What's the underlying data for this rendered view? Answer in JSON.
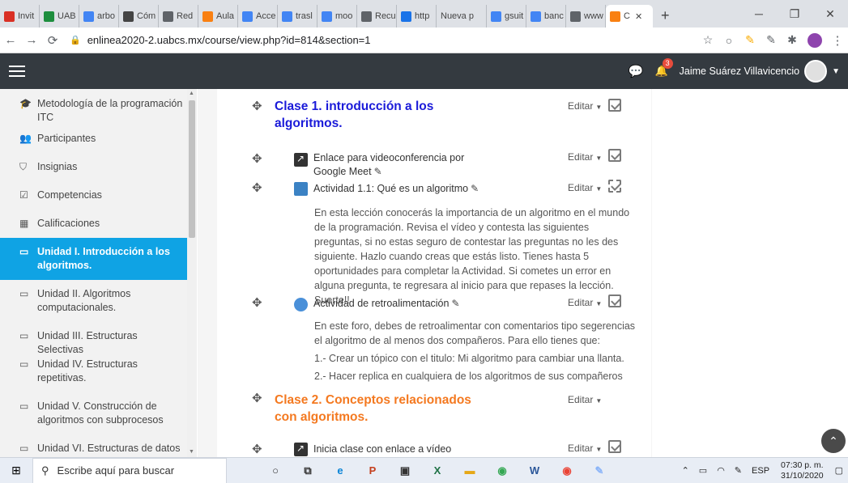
{
  "browser": {
    "tabs": [
      {
        "label": "Invit",
        "icon": "gmail-icon",
        "color": "#d93025"
      },
      {
        "label": "UAB",
        "icon": "classroom-icon",
        "color": "#1e8e3e"
      },
      {
        "label": "arbo",
        "icon": "google-icon",
        "color": "#4285f4"
      },
      {
        "label": "Cóm",
        "icon": "video-icon",
        "color": "#444"
      },
      {
        "label": "Red",
        "icon": "globe-icon",
        "color": "#5f6368"
      },
      {
        "label": "Aula",
        "icon": "moodle-icon",
        "color": "#f98012"
      },
      {
        "label": "Acce",
        "icon": "google-icon",
        "color": "#4285f4"
      },
      {
        "label": "trasl",
        "icon": "google-icon",
        "color": "#4285f4"
      },
      {
        "label": "moo",
        "icon": "google-icon",
        "color": "#4285f4"
      },
      {
        "label": "Recu",
        "icon": "lab-icon",
        "color": "#5f6368"
      },
      {
        "label": "http",
        "icon": "window-icon",
        "color": "#1a73e8"
      },
      {
        "label": "Nueva p",
        "icon": "",
        "color": ""
      },
      {
        "label": "gsuit",
        "icon": "google-icon",
        "color": "#4285f4"
      },
      {
        "label": "banc",
        "icon": "google-icon",
        "color": "#4285f4"
      },
      {
        "label": "www",
        "icon": "globe-icon",
        "color": "#5f6368"
      },
      {
        "label": "C",
        "icon": "moodle-icon",
        "color": "#f98012",
        "active": true
      }
    ],
    "url": "enlinea2020-2.uabcs.mx/course/view.php?id=814&section=1"
  },
  "navbar": {
    "notification_count": "3",
    "user_name": "Jaime Suárez Villavicencio"
  },
  "drawer": {
    "items": [
      {
        "label": "Metodología de la programación ITC",
        "icon": "graduation-cap-icon"
      },
      {
        "label": "Participantes",
        "icon": "users-icon"
      },
      {
        "label": "Insignias",
        "icon": "shield-icon"
      },
      {
        "label": "Competencias",
        "icon": "checkbox-icon"
      },
      {
        "label": "Calificaciones",
        "icon": "table-icon"
      },
      {
        "label": "Unidad I. Introducción a los algoritmos.",
        "icon": "folder-icon",
        "active": true
      },
      {
        "label": "Unidad II. Algoritmos computacionales.",
        "icon": "folder-icon"
      },
      {
        "label": "Unidad III. Estructuras Selectivas",
        "icon": "folder-icon"
      },
      {
        "label": "Unidad IV. Estructuras repetitivas.",
        "icon": "folder-icon"
      },
      {
        "label": "Unidad V. Construcción de algoritmos con subprocesos",
        "icon": "folder-icon"
      },
      {
        "label": "Unidad VI. Estructuras de datos",
        "icon": "folder-icon"
      }
    ]
  },
  "content": {
    "edit_label": "Editar",
    "section1": {
      "title": "Clase 1. introducción a los algoritmos.",
      "color": "#1a1ad9",
      "activities": [
        {
          "label": "Enlace para videoconferencia por Google Meet",
          "icon": "url-icon"
        },
        {
          "label": "Actividad 1.1: Qué es un algoritmo",
          "icon": "book-icon"
        }
      ],
      "description": "En esta lección conocerás la importancia de un algoritmo en el mundo de la programación. Revisa el vídeo y contesta las siguientes preguntas, si no estas seguro de contestar las preguntas no les des siguiente. Hazlo cuando creas que estás listo. Tienes hasta 5 oportunidades para completar la Actividad. Si cometes un error en alguna pregunta, te regresara al inicio para que repases la lección. Suerte!!",
      "forum": "Actividad de retroalimentación",
      "forum_text": "En este foro, debes de retroalimentar con comentarios tipo segerencias el algoritmo de al menos dos compañeros. Para ello tienes que:",
      "forum_step1": "1.- Crear un tópico con el titulo: Mi algoritmo para cambiar una llanta.",
      "forum_step2": "2.- Hacer replica en cualquiera de los algoritmos de sus compañeros"
    },
    "section2": {
      "title": "Clase 2. Conceptos relacionados con algoritmos.",
      "color": "#f47920",
      "activity": "Inicia clase con enlace a vídeo"
    }
  },
  "taskbar": {
    "search_placeholder": "Escribe aquí para buscar",
    "language": "ESP",
    "time": "07:30 p. m.",
    "date": "31/10/2020"
  }
}
